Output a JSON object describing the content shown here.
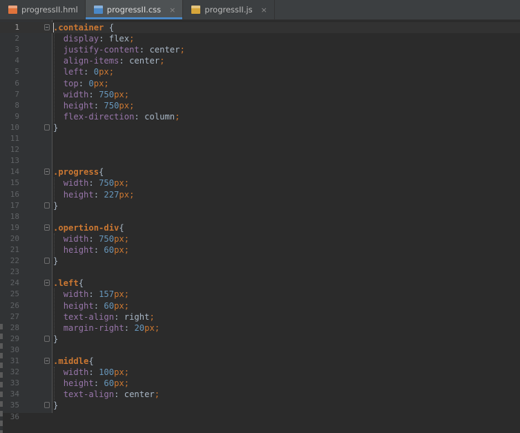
{
  "tabs": [
    {
      "label": "progressII.hml",
      "icon": "html-file-icon",
      "color": "#e0733b",
      "active": false
    },
    {
      "label": "progressII.css",
      "icon": "css-file-icon",
      "color": "#4a88c7",
      "active": true
    },
    {
      "label": "progressII.js",
      "icon": "js-file-icon",
      "color": "#d6a53a",
      "active": false
    }
  ],
  "tab_close": "×",
  "current_line": 1,
  "lines": [
    {
      "n": "1",
      "text": ".container {"
    },
    {
      "n": "2",
      "text": "  display: flex;"
    },
    {
      "n": "3",
      "text": "  justify-content: center;"
    },
    {
      "n": "4",
      "text": "  align-items: center;"
    },
    {
      "n": "5",
      "text": "  left: 0px;"
    },
    {
      "n": "6",
      "text": "  top: 0px;"
    },
    {
      "n": "7",
      "text": "  width: 750px;"
    },
    {
      "n": "8",
      "text": "  height: 750px;"
    },
    {
      "n": "9",
      "text": "  flex-direction: column;"
    },
    {
      "n": "10",
      "text": "}"
    },
    {
      "n": "11",
      "text": ""
    },
    {
      "n": "12",
      "text": ""
    },
    {
      "n": "13",
      "text": ""
    },
    {
      "n": "14",
      "text": ".progress{"
    },
    {
      "n": "15",
      "text": "  width: 750px;"
    },
    {
      "n": "16",
      "text": "  height: 227px;"
    },
    {
      "n": "17",
      "text": "}"
    },
    {
      "n": "18",
      "text": ""
    },
    {
      "n": "19",
      "text": ".opertion-div{"
    },
    {
      "n": "20",
      "text": "  width: 750px;"
    },
    {
      "n": "21",
      "text": "  height: 60px;"
    },
    {
      "n": "22",
      "text": "}"
    },
    {
      "n": "23",
      "text": ""
    },
    {
      "n": "24",
      "text": ".left{"
    },
    {
      "n": "25",
      "text": "  width: 157px;"
    },
    {
      "n": "26",
      "text": "  height: 60px;"
    },
    {
      "n": "27",
      "text": "  text-align: right;"
    },
    {
      "n": "28",
      "text": "  margin-right: 20px;"
    },
    {
      "n": "29",
      "text": "}"
    },
    {
      "n": "30",
      "text": ""
    },
    {
      "n": "31",
      "text": ".middle{"
    },
    {
      "n": "32",
      "text": "  width: 100px;"
    },
    {
      "n": "33",
      "text": "  height: 60px;"
    },
    {
      "n": "34",
      "text": "  text-align: center;"
    },
    {
      "n": "35",
      "text": "}"
    },
    {
      "n": "36",
      "text": ""
    }
  ]
}
